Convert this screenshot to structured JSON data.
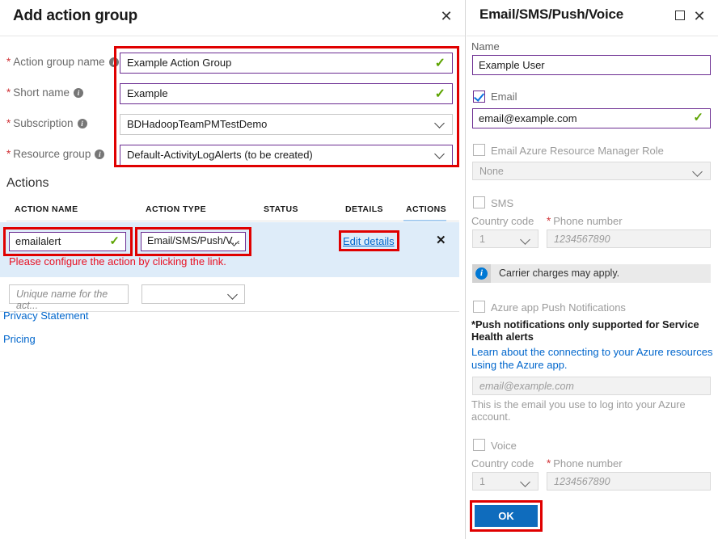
{
  "left_blade": {
    "title": "Add action group",
    "close_icon": "close-icon",
    "fields": [
      {
        "label": "Action group name",
        "required": true,
        "value": "Example Action Group",
        "type": "text",
        "valid": true,
        "focus_border": "#6b2c91"
      },
      {
        "label": "Short name",
        "required": true,
        "value": "Example",
        "type": "text",
        "valid": true,
        "focus_border": "#6b2c91"
      },
      {
        "label": "Subscription",
        "required": true,
        "value": "BDHadoopTeamPMTestDemo",
        "type": "select",
        "valid": false,
        "focus_border": "#c8c8c8"
      },
      {
        "label": "Resource group",
        "required": true,
        "value": "Default-ActivityLogAlerts (to be created)",
        "type": "select",
        "valid": false,
        "focus_border": "#6b2c91"
      }
    ],
    "actions_section": {
      "heading": "Actions",
      "columns": [
        "ACTION NAME",
        "ACTION TYPE",
        "STATUS",
        "DETAILS",
        "ACTIONS"
      ],
      "rows": [
        {
          "name": "emailalert",
          "name_valid": true,
          "type": "Email/SMS/Push/V...",
          "status": "",
          "details_link": "Edit details",
          "remove_icon": "close-icon",
          "error": "Please configure the action by clicking the link."
        }
      ],
      "new_row": {
        "name_placeholder": "Unique name for the act...",
        "type_value": ""
      }
    },
    "footer_links": [
      "Privacy Statement",
      "Pricing"
    ]
  },
  "right_blade": {
    "title": "Email/SMS/Push/Voice",
    "maximize_icon": "maximize-icon",
    "close_icon": "close-icon",
    "name": {
      "label": "Name",
      "value": "Example User"
    },
    "email": {
      "checkbox_label": "Email",
      "checked": true,
      "value": "email@example.com",
      "valid": true
    },
    "arm_role": {
      "checkbox_label": "Email Azure Resource Manager Role",
      "checked": false,
      "select_value": "None"
    },
    "sms": {
      "checkbox_label": "SMS",
      "checked": false,
      "country_code_label": "Country code",
      "country_code_value": "1",
      "phone_label": "Phone number",
      "phone_required": true,
      "phone_placeholder": "1234567890"
    },
    "carrier_notice": {
      "icon": "info-icon",
      "text": "Carrier charges may apply."
    },
    "push": {
      "checkbox_label": "Azure app Push Notifications",
      "checked": false,
      "note": "*Push notifications only supported for Service Health alerts",
      "link": "Learn about the connecting to your Azure resources using the Azure app.",
      "email_placeholder": "email@example.com",
      "help": "This is the email you use to log into your Azure account."
    },
    "voice": {
      "checkbox_label": "Voice",
      "checked": false,
      "country_code_label": "Country code",
      "country_code_value": "1",
      "phone_label": "Phone number",
      "phone_required": true,
      "phone_placeholder": "1234567890"
    },
    "ok_button": "OK"
  },
  "colors": {
    "highlight_red": "#e00000",
    "focus_purple": "#6b2c91",
    "valid_green": "#5ca300",
    "link_blue": "#0066cc",
    "error_red": "#e81123",
    "selected_row_blue": "#deecf9",
    "primary_button": "#0f6cbd"
  }
}
